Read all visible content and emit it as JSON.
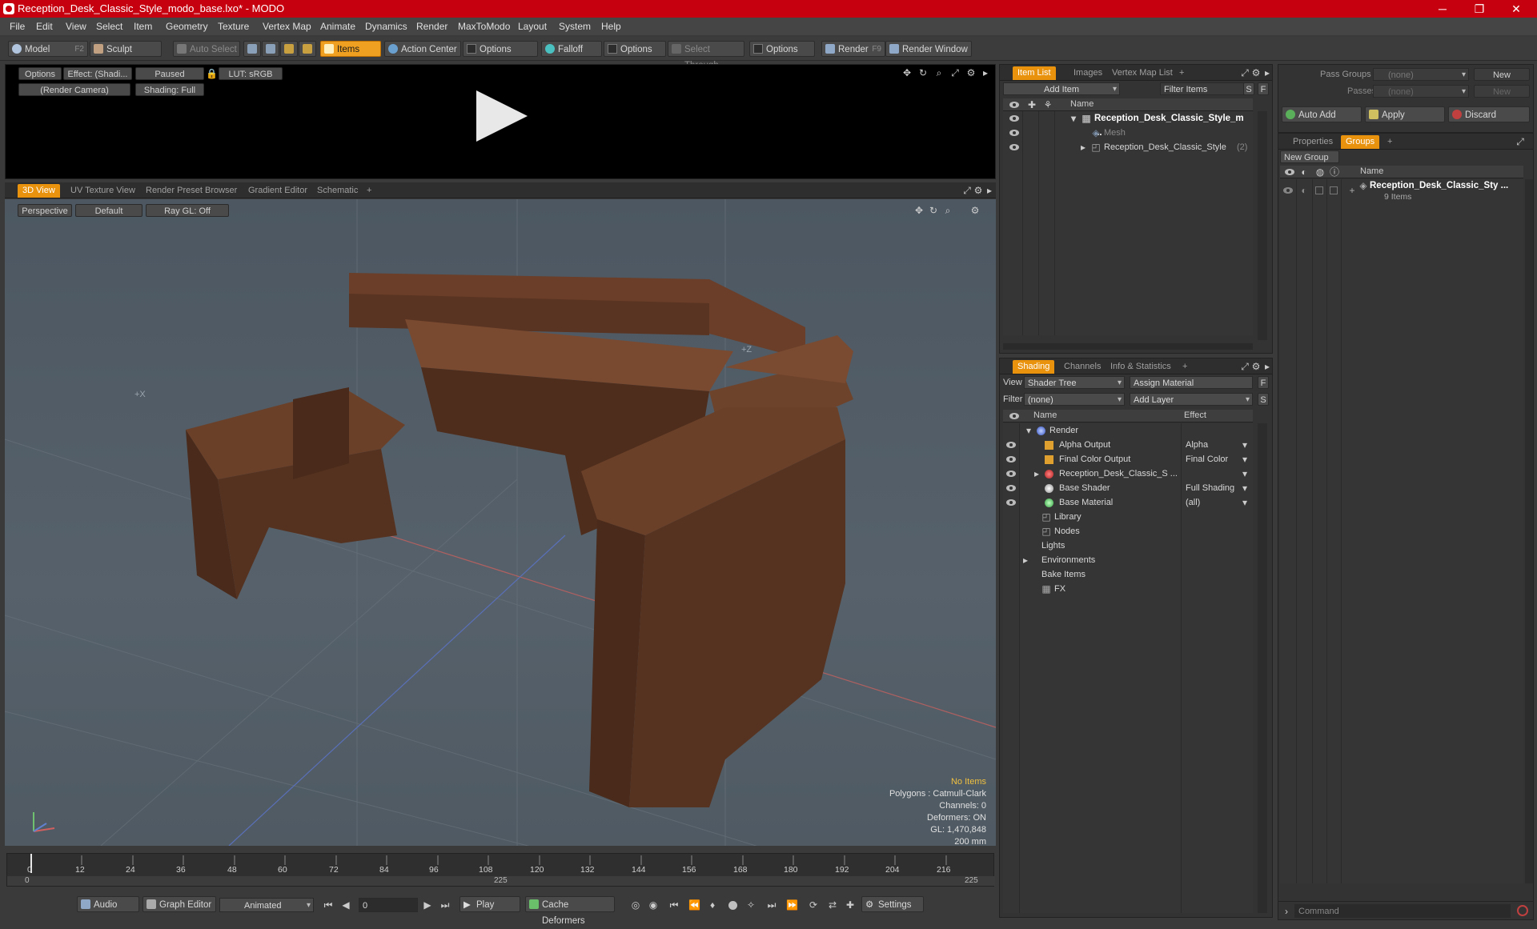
{
  "window": {
    "title": "Reception_Desk_Classic_Style_modo_base.lxo* - MODO",
    "min": "─",
    "max": "❐",
    "close": "✕"
  },
  "menu": [
    "File",
    "Edit",
    "View",
    "Select",
    "Item",
    "Geometry",
    "Texture",
    "Vertex Map",
    "Animate",
    "Dynamics",
    "Render",
    "MaxToModo",
    "Layout",
    "System",
    "Help"
  ],
  "toolbar": {
    "model": "Model",
    "model_key": "F2",
    "sculpt": "Sculpt",
    "auto_select": "Auto Select",
    "items": "Items",
    "action_center": "Action Center",
    "options1": "Options",
    "falloff": "Falloff",
    "options2": "Options",
    "select_through": "Select Through",
    "options3": "Options",
    "render": "Render",
    "render_key": "F9",
    "render_window": "Render Window"
  },
  "preview": {
    "options": "Options",
    "effect": "Effect: (Shadi...",
    "paused": "Paused",
    "lut": "LUT: sRGB",
    "camera": "(Render Camera)",
    "shading": "Shading: Full"
  },
  "viewtabs": [
    "3D View",
    "UV Texture View",
    "Render Preset Browser",
    "Gradient Editor",
    "Schematic",
    "+"
  ],
  "viewport": {
    "perspective": "Perspective",
    "default": "Default",
    "raygl": "Ray GL: Off",
    "axis_x": "+X",
    "axis_z": "+Z",
    "hud": {
      "no_items": "No Items",
      "polygons": "Polygons : Catmull-Clark",
      "channels": "Channels: 0",
      "deformers": "Deformers: ON",
      "gl": "GL: 1,470,848",
      "size": "200 mm"
    }
  },
  "timeline": {
    "ticks": [
      "0",
      "12",
      "24",
      "36",
      "48",
      "60",
      "72",
      "84",
      "96",
      "108",
      "120",
      "132",
      "144",
      "156",
      "168",
      "180",
      "192",
      "204",
      "216"
    ],
    "start": "0",
    "mid": "225",
    "end": "225"
  },
  "bottombar": {
    "audio": "Audio",
    "graph_editor": "Graph Editor",
    "animated": "Animated",
    "frame": "0",
    "play": "Play",
    "cache": "Cache Deformers",
    "settings": "Settings"
  },
  "itemlist": {
    "tabs": [
      "Item List",
      "Images",
      "Vertex Map List",
      "+"
    ],
    "add_item": "Add Item",
    "filter": "Filter Items",
    "s": "S",
    "f": "F",
    "col_name": "Name",
    "rows": [
      {
        "label": "Reception_Desk_Classic_Style_m ...",
        "count": ""
      },
      {
        "label": "Mesh",
        "count": ""
      },
      {
        "label": "Reception_Desk_Classic_Style",
        "count": "(2)"
      }
    ]
  },
  "shading": {
    "tabs": [
      "Shading",
      "Channels",
      "Info & Statistics",
      "+"
    ],
    "view_label": "View",
    "view_val": "Shader Tree",
    "assign": "Assign Material",
    "f": "F",
    "filter_label": "Filter",
    "filter_val": "(none)",
    "add_layer": "Add Layer",
    "s": "S",
    "col_name": "Name",
    "col_effect": "Effect",
    "rows": [
      {
        "name": "Render",
        "effect": ""
      },
      {
        "name": "Alpha Output",
        "effect": "Alpha"
      },
      {
        "name": "Final Color Output",
        "effect": "Final Color"
      },
      {
        "name": "Reception_Desk_Classic_S ...",
        "effect": ""
      },
      {
        "name": "Base Shader",
        "effect": "Full Shading"
      },
      {
        "name": "Base Material",
        "effect": "(all)"
      },
      {
        "name": "Library",
        "effect": ""
      },
      {
        "name": "Nodes",
        "effect": ""
      },
      {
        "name": "Lights",
        "effect": ""
      },
      {
        "name": "Environments",
        "effect": ""
      },
      {
        "name": "Bake Items",
        "effect": ""
      },
      {
        "name": "FX",
        "effect": ""
      }
    ]
  },
  "right": {
    "pass_groups": "Pass Groups",
    "passes": "Passes",
    "none": "(none)",
    "new": "New",
    "auto_add": "Auto Add",
    "apply": "Apply",
    "discard": "Discard",
    "tabs": [
      "Properties",
      "Groups",
      "+"
    ],
    "new_group": "New Group",
    "col_name": "Name",
    "group_name": "Reception_Desk_Classic_Sty ...",
    "group_count": "9 Items",
    "command": "Command"
  },
  "colors": {
    "accent": "#e8920e",
    "title": "#c6000f",
    "viewport": "#4f5b66",
    "wood": "#5a3422"
  }
}
